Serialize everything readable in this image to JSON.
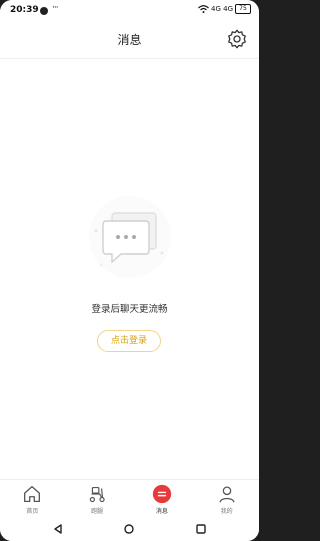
{
  "status_bar": {
    "time": "20:39",
    "dots": "···",
    "signal": "4G 4G",
    "battery": "75"
  },
  "header": {
    "title": "消息",
    "settings_icon": "gear-icon"
  },
  "empty_state": {
    "illustration": "chat-bubble-icon",
    "message": "登录后聊天更流畅",
    "login_button": "点击登录"
  },
  "tabbar": {
    "tabs": [
      {
        "label": "首页",
        "icon": "home-icon"
      },
      {
        "label": "跑腿",
        "icon": "scooter-icon"
      },
      {
        "label": "消息",
        "icon": "message-icon",
        "active": true
      },
      {
        "label": "我的",
        "icon": "profile-icon"
      }
    ]
  },
  "nav_bar": {
    "back_icon": "back-triangle-icon",
    "home_icon": "home-circle-icon",
    "recents_icon": "recents-square-icon"
  },
  "colors": {
    "accent_red": "#e73a3a",
    "login_gold": "#d2a116"
  }
}
